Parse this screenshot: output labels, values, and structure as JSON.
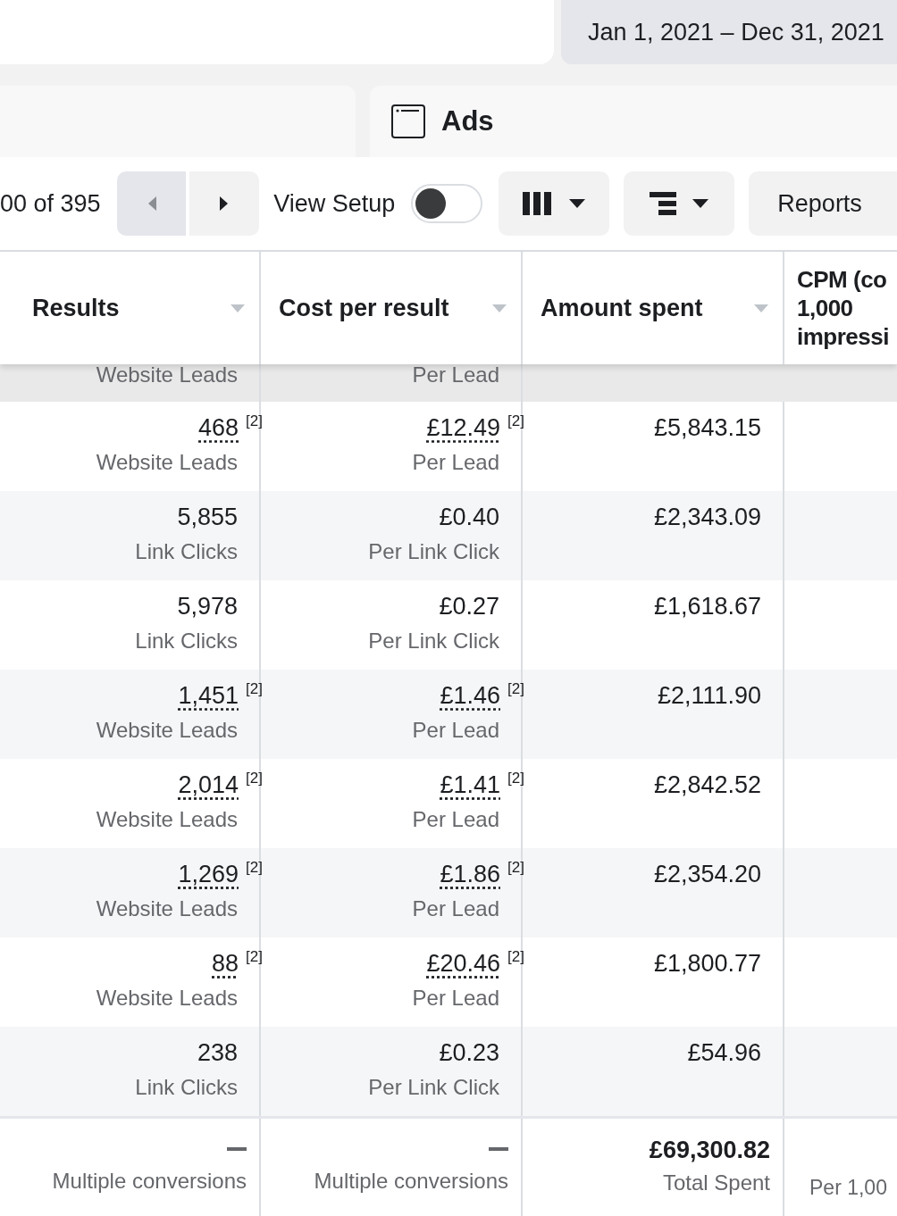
{
  "date_range": "Jan 1, 2021 – Dec 31, 2021",
  "tab": {
    "label": "Ads"
  },
  "toolbar": {
    "page_count": "00 of 395",
    "prev": {
      "disabled": true
    },
    "next": {
      "disabled": false
    },
    "view_setup": {
      "label": "View Setup",
      "on": false
    },
    "reports": "Reports"
  },
  "table": {
    "columns": [
      {
        "label": "Results",
        "sortable": true
      },
      {
        "label": "Cost per result",
        "sortable": true
      },
      {
        "label": "Amount spent",
        "sortable": true
      },
      {
        "label": "CPM (co\n1,000\nimpressi"
      }
    ],
    "rows": [
      {
        "highlighted": true,
        "results": null,
        "results_sub": "Website Leads",
        "cost": null,
        "cost_sub": "Per Lead",
        "spent": null
      },
      {
        "highlighted": false,
        "results": {
          "value": "468",
          "note": "[2]"
        },
        "results_sub": "Website Leads",
        "cost": {
          "value": "£12.49",
          "note": "[2]"
        },
        "cost_sub": "Per Lead",
        "spent": "£5,843.15"
      },
      {
        "highlighted": false,
        "results": {
          "value": "5,855"
        },
        "results_sub": "Link Clicks",
        "cost": {
          "value": "£0.40"
        },
        "cost_sub": "Per Link Click",
        "spent": "£2,343.09"
      },
      {
        "highlighted": false,
        "results": {
          "value": "5,978"
        },
        "results_sub": "Link Clicks",
        "cost": {
          "value": "£0.27"
        },
        "cost_sub": "Per Link Click",
        "spent": "£1,618.67"
      },
      {
        "highlighted": false,
        "results": {
          "value": "1,451",
          "note": "[2]"
        },
        "results_sub": "Website Leads",
        "cost": {
          "value": "£1.46",
          "note": "[2]"
        },
        "cost_sub": "Per Lead",
        "spent": "£2,111.90"
      },
      {
        "highlighted": false,
        "results": {
          "value": "2,014",
          "note": "[2]"
        },
        "results_sub": "Website Leads",
        "cost": {
          "value": "£1.41",
          "note": "[2]"
        },
        "cost_sub": "Per Lead",
        "spent": "£2,842.52"
      },
      {
        "highlighted": false,
        "results": {
          "value": "1,269",
          "note": "[2]"
        },
        "results_sub": "Website Leads",
        "cost": {
          "value": "£1.86",
          "note": "[2]"
        },
        "cost_sub": "Per Lead",
        "spent": "£2,354.20"
      },
      {
        "highlighted": false,
        "results": {
          "value": "88",
          "note": "[2]"
        },
        "results_sub": "Website Leads",
        "cost": {
          "value": "£20.46",
          "note": "[2]"
        },
        "cost_sub": "Per Lead",
        "spent": "£1,800.77"
      },
      {
        "highlighted": false,
        "results": {
          "value": "238"
        },
        "results_sub": "Link Clicks",
        "cost": {
          "value": "£0.23"
        },
        "cost_sub": "Per Link Click",
        "spent": "£54.96"
      }
    ],
    "totals": {
      "results_sub": "Multiple conversions",
      "cost_sub": "Multiple conversions",
      "spent": "£69,300.82",
      "spent_sub": "Total Spent",
      "cpm_sub": "Per 1,00"
    }
  }
}
